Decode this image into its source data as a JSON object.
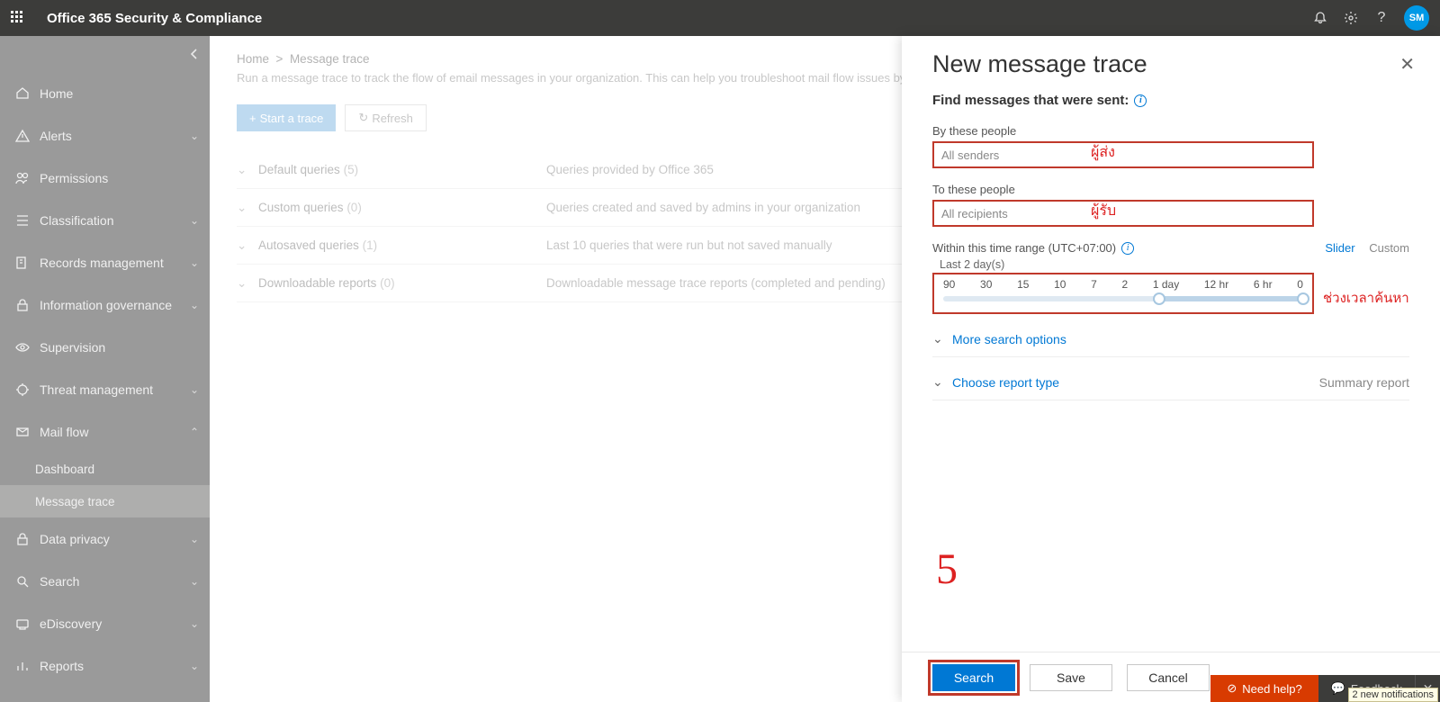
{
  "header": {
    "title": "Office 365 Security & Compliance",
    "avatar_initials": "SM"
  },
  "sidebar": {
    "items": [
      {
        "icon": "home",
        "label": "Home",
        "expandable": false
      },
      {
        "icon": "alert",
        "label": "Alerts",
        "expandable": true
      },
      {
        "icon": "permissions",
        "label": "Permissions",
        "expandable": false
      },
      {
        "icon": "classification",
        "label": "Classification",
        "expandable": true
      },
      {
        "icon": "records",
        "label": "Records management",
        "expandable": true
      },
      {
        "icon": "lock",
        "label": "Information governance",
        "expandable": true
      },
      {
        "icon": "eye",
        "label": "Supervision",
        "expandable": false
      },
      {
        "icon": "threat",
        "label": "Threat management",
        "expandable": true
      },
      {
        "icon": "mail",
        "label": "Mail flow",
        "expandable": true,
        "expanded": true,
        "children": [
          {
            "label": "Dashboard",
            "active": false
          },
          {
            "label": "Message trace",
            "active": true
          }
        ]
      },
      {
        "icon": "lock",
        "label": "Data privacy",
        "expandable": true
      },
      {
        "icon": "search",
        "label": "Search",
        "expandable": true
      },
      {
        "icon": "ediscovery",
        "label": "eDiscovery",
        "expandable": true
      },
      {
        "icon": "reports",
        "label": "Reports",
        "expandable": true
      }
    ]
  },
  "content": {
    "breadcrumb_home": "Home",
    "breadcrumb_sep": ">",
    "breadcrumb_current": "Message trace",
    "description": "Run a message trace to track the flow of email messages in your organization. This can help you troubleshoot mail flow issues by deter",
    "start_button": "Start a trace",
    "refresh_button": "Refresh",
    "queries": [
      {
        "name": "Default queries",
        "count": "(5)",
        "desc": "Queries provided by Office 365"
      },
      {
        "name": "Custom queries",
        "count": "(0)",
        "desc": "Queries created and saved by admins in your organization"
      },
      {
        "name": "Autosaved queries",
        "count": "(1)",
        "desc": "Last 10 queries that were run but not saved manually"
      },
      {
        "name": "Downloadable reports",
        "count": "(0)",
        "desc": "Downloadable message trace reports (completed and pending)"
      }
    ]
  },
  "panel": {
    "title": "New message trace",
    "subtitle": "Find messages that were sent:",
    "sender_label": "By these people",
    "sender_placeholder": "All senders",
    "sender_annotation": "ผู้ส่ง",
    "recipient_label": "To these people",
    "recipient_placeholder": "All recipients",
    "recipient_annotation": "ผู้รับ",
    "time_label": "Within this time range (UTC+07:00)",
    "time_tab_slider": "Slider",
    "time_tab_custom": "Custom",
    "time_summary": "Last 2 day(s)",
    "time_ticks": [
      "90",
      "30",
      "15",
      "10",
      "7",
      "2",
      "1 day",
      "12 hr",
      "6 hr",
      "0"
    ],
    "time_annotation": "ช่วงเวลาค้นหา",
    "more_options": "More search options",
    "report_type": "Choose report type",
    "report_summary": "Summary report",
    "step_number": "5",
    "btn_search": "Search",
    "btn_save": "Save",
    "btn_cancel": "Cancel"
  },
  "helpbar": {
    "need_help": "Need help?",
    "feedback": "Feedback",
    "tooltip": "2 new notifications"
  }
}
